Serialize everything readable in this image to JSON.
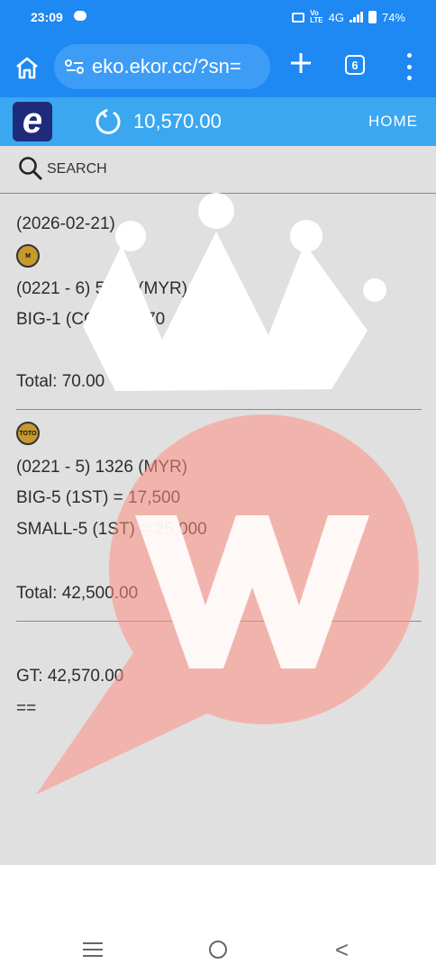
{
  "status_bar": {
    "time": "23:09",
    "network": "4G",
    "battery": "74%"
  },
  "browser": {
    "url": "eko.ekor.cc/?sn=",
    "tab_count": "6"
  },
  "header": {
    "logo_letter": "e",
    "balance": "10,570.00",
    "home_label": "HOME"
  },
  "search": {
    "label": "SEARCH"
  },
  "ticket": {
    "date": "(2026-02-21)",
    "groups": [
      {
        "badge": "M",
        "draw": "(0221 - 6) 5668 (MYR)",
        "bets": [
          "BIG-1 (CONS) = 70"
        ],
        "total": "Total: 70.00"
      },
      {
        "badge": "TOTO",
        "draw": "(0221 - 5) 1326 (MYR)",
        "bets": [
          "BIG-5 (1ST) = 17,500",
          "SMALL-5 (1ST) = 25,000"
        ],
        "total": "Total: 42,500.00"
      }
    ],
    "grand_total": "GT: 42,570.00",
    "end_marker": "=="
  },
  "colors": {
    "browser_blue": "#1e88f3",
    "header_blue": "#3aa7f0",
    "logo_navy": "#1f2b7a",
    "content_gray": "#e0e0e0",
    "badge_gold": "#c69a2e"
  },
  "icons": [
    "home-icon",
    "site-settings-icon",
    "plus-icon",
    "tab-switcher-icon",
    "more-vert-icon",
    "refresh-icon",
    "search-icon",
    "crown-icon",
    "chat-bubble-icon"
  ]
}
